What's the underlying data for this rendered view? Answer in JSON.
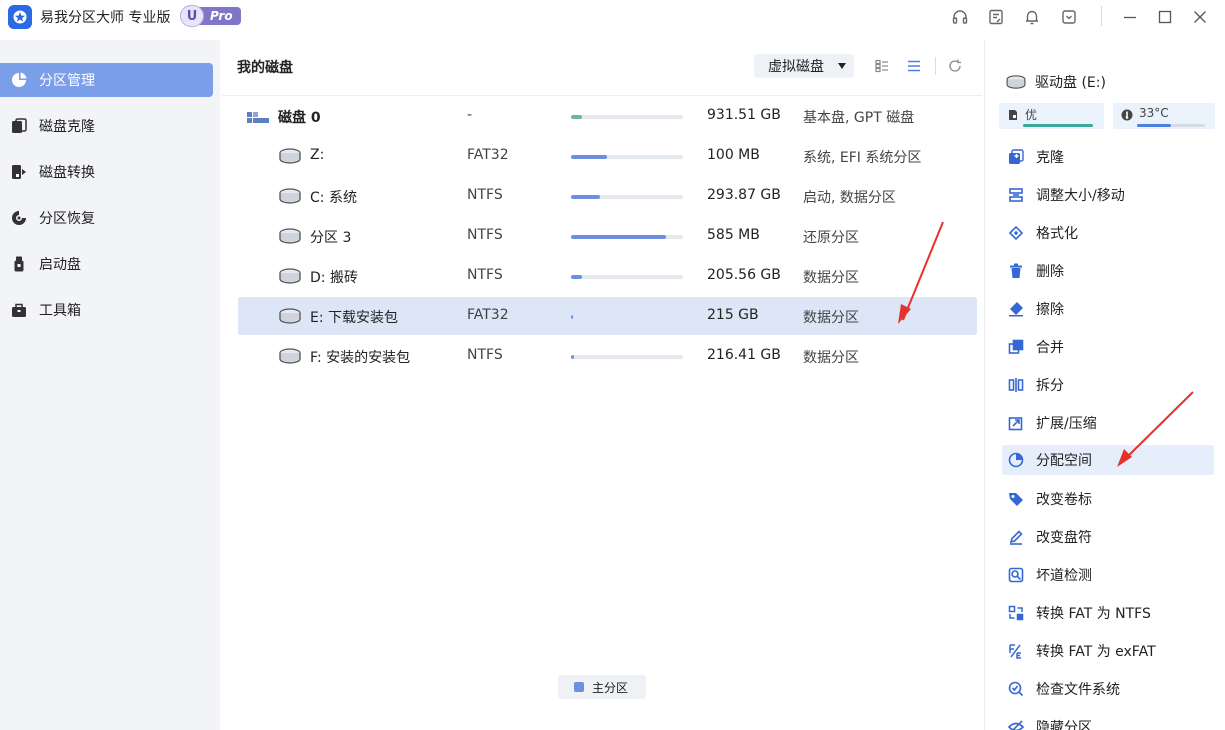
{
  "app": {
    "title": "易我分区大师 专业版",
    "badge_letter": "U",
    "badge_text": "Pro"
  },
  "sidebar": {
    "items": [
      {
        "label": "分区管理",
        "icon": "pie-chart-icon",
        "active": true
      },
      {
        "label": "磁盘克隆",
        "icon": "clone-icon"
      },
      {
        "label": "磁盘转换",
        "icon": "convert-icon"
      },
      {
        "label": "分区恢复",
        "icon": "recovery-icon"
      },
      {
        "label": "启动盘",
        "icon": "usb-icon"
      },
      {
        "label": "工具箱",
        "icon": "toolbox-icon"
      }
    ]
  },
  "main": {
    "title": "我的磁盘",
    "virtual_disk_label": "虚拟磁盘",
    "disk": {
      "name": "磁盘 0",
      "fs": "-",
      "usage": 0.1,
      "size": "931.51 GB",
      "desc": "基本盘, GPT 磁盘"
    },
    "partitions": [
      {
        "name": "Z:",
        "fs": "FAT32",
        "usage": 0.32,
        "size": "100 MB",
        "desc": "系统, EFI 系统分区"
      },
      {
        "name": "C: 系统",
        "fs": "NTFS",
        "usage": 0.26,
        "size": "293.87 GB",
        "desc": "启动, 数据分区"
      },
      {
        "name": "分区 3",
        "fs": "NTFS",
        "usage": 0.85,
        "size": "585 MB",
        "desc": "还原分区"
      },
      {
        "name": "D: 搬砖",
        "fs": "NTFS",
        "usage": 0.1,
        "size": "205.56 GB",
        "desc": "数据分区"
      },
      {
        "name": "E: 下载安装包",
        "fs": "FAT32",
        "usage": 0.01,
        "size": "215 GB",
        "desc": "数据分区",
        "selected": true
      },
      {
        "name": "F: 安装的安装包",
        "fs": "NTFS",
        "usage": 0.03,
        "size": "216.41 GB",
        "desc": "数据分区"
      }
    ],
    "legend_label": "主分区"
  },
  "right_panel": {
    "drive_label": "驱动盘 (E:)",
    "health_label": "优",
    "temp_label": "33°C",
    "operations": [
      {
        "label": "克隆",
        "icon": "clone-plus-icon"
      },
      {
        "label": "调整大小/移动",
        "icon": "resize-icon"
      },
      {
        "label": "格式化",
        "icon": "format-icon"
      },
      {
        "label": "删除",
        "icon": "trash-icon"
      },
      {
        "label": "擦除",
        "icon": "eraser-icon"
      },
      {
        "label": "合并",
        "icon": "merge-icon"
      },
      {
        "label": "拆分",
        "icon": "split-icon"
      },
      {
        "label": "扩展/压缩",
        "icon": "extend-icon"
      },
      {
        "label": "分配空间",
        "icon": "allocate-icon",
        "highlight": true
      },
      {
        "label": "改变卷标",
        "icon": "tag-icon"
      },
      {
        "label": "改变盘符",
        "icon": "pen-icon"
      },
      {
        "label": "坏道检测",
        "icon": "scan-icon"
      },
      {
        "label": "转换 FAT 为 NTFS",
        "icon": "convert-ntfs-icon"
      },
      {
        "label": "转换 FAT 为 exFAT",
        "icon": "convert-exfat-icon"
      },
      {
        "label": "检查文件系统",
        "icon": "check-fs-icon"
      },
      {
        "label": "隐藏分区",
        "icon": "hide-icon"
      }
    ]
  },
  "colors": {
    "accent": "#7a9ee8",
    "bar_fill": "#6c8fe0",
    "health_meter": "#3aa79b",
    "temp_meter": "#4b7fe0",
    "arrow": "#e5322d"
  }
}
